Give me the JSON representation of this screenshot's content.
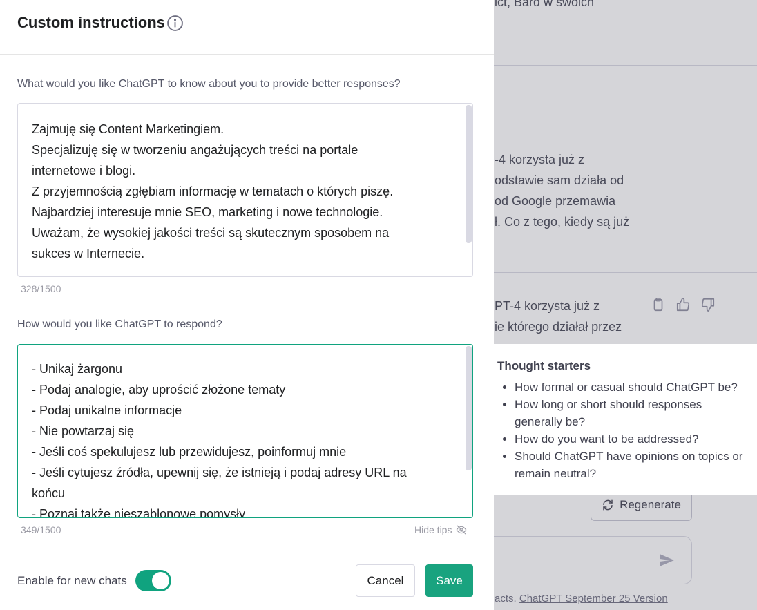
{
  "background": {
    "top_fragment": "ict, Bard w swoich",
    "para1": [
      "-4 korzysta już z",
      "odstawie sam działa od",
      "od Google przemawia",
      "ł. Co z tego, kiedy są już"
    ],
    "para2": [
      "PT-4 korzysta już z",
      "ie którego działał przez"
    ],
    "regenerate_label": "Regenerate",
    "footer_prefix": "acts. ",
    "footer_link": "ChatGPT September 25 Version"
  },
  "modal": {
    "title": "Custom instructions",
    "question1": "What would you like ChatGPT to know about you to provide better responses?",
    "answer1_lines": [
      "Zajmuję się Content Marketingiem.",
      "Specjalizuję się w tworzeniu angażujących treści na portale",
      "internetowe i blogi.",
      "Z przyjemnością zgłębiam informację w tematach o których piszę.",
      "Najbardziej interesuje mnie  SEO, marketing i nowe technologie.",
      "Uważam, że wysokiej jakości treści są skutecznym sposobem na",
      "sukces w Internecie."
    ],
    "counter1": "328/1500",
    "question2": "How would you like ChatGPT to respond?",
    "answer2_lines": [
      "- Unikaj żargonu",
      "- Podaj analogie, aby uprościć złożone tematy",
      "- Podaj unikalne informacje",
      "- Nie powtarzaj się",
      "- Jeśli coś spekulujesz lub przewidujesz, poinformuj mnie",
      "- Jeśli cytujesz źródła, upewnij się, że istnieją i podaj adresy URL na",
      "końcu",
      "- Poznaj także nieszablonowe pomysły"
    ],
    "counter2": "349/1500",
    "hide_tips": "Hide tips",
    "enable_label": "Enable for new chats",
    "enable_on": true,
    "cancel_label": "Cancel",
    "save_label": "Save"
  },
  "tips": {
    "title": "Thought starters",
    "items": [
      "How formal or casual should ChatGPT be?",
      "How long or short should responses generally be?",
      "How do you want to be addressed?",
      "Should ChatGPT have opinions on topics or remain neutral?"
    ]
  },
  "colors": {
    "accent": "#10a37f",
    "save_button": "#19a37f",
    "overlay": "#565869"
  },
  "icons": {
    "info": "info-icon",
    "hide_tips": "eye-slash-icon",
    "copy": "clipboard-icon",
    "thumbs_up": "thumbs-up-icon",
    "thumbs_down": "thumbs-down-icon",
    "regenerate": "refresh-icon",
    "send": "send-icon"
  }
}
